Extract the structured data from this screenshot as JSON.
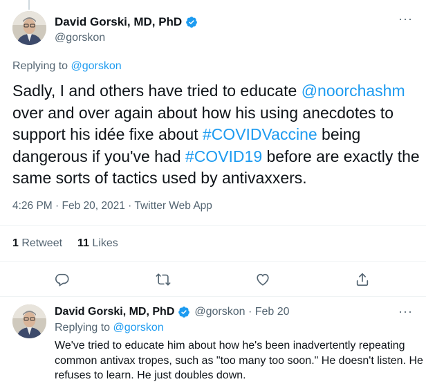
{
  "main_tweet": {
    "author_name": "David Gorski, MD, PhD",
    "author_handle": "@gorskon",
    "replying_prefix": "Replying to ",
    "replying_handle": "@gorskon",
    "text_segments": [
      {
        "text": "Sadly, I and others have tried to educate ",
        "type": "text"
      },
      {
        "text": "@noorchashm",
        "type": "link"
      },
      {
        "text": " over and over again about how his using anecdotes to support his idée fixe about ",
        "type": "text"
      },
      {
        "text": "#COVIDVaccine",
        "type": "link"
      },
      {
        "text": " being dangerous if you've had ",
        "type": "text"
      },
      {
        "text": "#COVID19",
        "type": "link"
      },
      {
        "text": " before are exactly the same sorts of tactics used by antivaxxers.",
        "type": "text"
      }
    ],
    "meta": "4:26 PM · Feb 20, 2021 · Twitter Web App",
    "retweet_count": "1",
    "retweet_label": " Retweet",
    "like_count": "11",
    "like_label": " Likes",
    "more_label": "···"
  },
  "actions": [
    {
      "name": "reply",
      "icon": "reply-icon"
    },
    {
      "name": "retweet",
      "icon": "retweet-icon"
    },
    {
      "name": "like",
      "icon": "heart-icon"
    },
    {
      "name": "share",
      "icon": "share-icon"
    }
  ],
  "reply_tweet": {
    "author_name": "David Gorski, MD, PhD",
    "author_handle": "@gorskon · Feb 20",
    "replying_prefix": "Replying to ",
    "replying_handle": "@gorskon",
    "text": "We've tried to educate him about how he's been inadvertently repeating common antivax tropes, such as \"too many too soon.\" He doesn't listen. He refuses to learn. He just doubles down.",
    "more_label": "···"
  },
  "colors": {
    "link": "#1d9bf0",
    "muted": "#536471",
    "text": "#0f1419",
    "divider": "#eff3f4"
  }
}
